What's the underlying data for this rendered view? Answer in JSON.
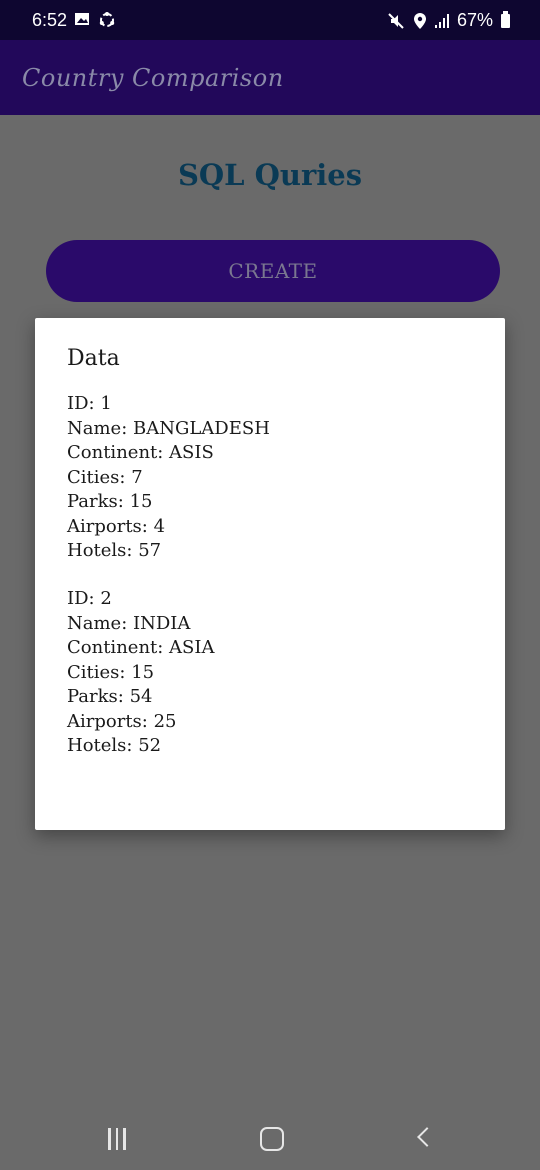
{
  "status_bar": {
    "time": "6:52",
    "battery": "67%",
    "icons": [
      "image-icon",
      "sync-icon",
      "mute-icon",
      "location-icon",
      "signal-icon",
      "battery-icon"
    ]
  },
  "app_bar": {
    "title": "Country Comparison",
    "color": "#22085a"
  },
  "screen": {
    "title": "SQL Quries"
  },
  "create_button": {
    "label": "CREATE",
    "color": "#2a0a6a"
  },
  "dialog": {
    "title": "Data",
    "records": [
      {
        "id": "ID: 1",
        "name": "Name: BANGLADESH",
        "continent": "Continent: ASIS",
        "cities": "Cities: 7",
        "parks": "Parks: 15",
        "airports": "Airports: 4",
        "hotels": "Hotels: 57"
      },
      {
        "id": "ID: 2",
        "name": "Name: INDIA",
        "continent": "Continent: ASIA",
        "cities": "Cities: 15",
        "parks": "Parks: 54",
        "airports": "Airports: 25",
        "hotels": "Hotels: 52"
      }
    ]
  },
  "nav_bar": {
    "icons": [
      "recent-apps-icon",
      "home-icon",
      "back-icon"
    ]
  }
}
